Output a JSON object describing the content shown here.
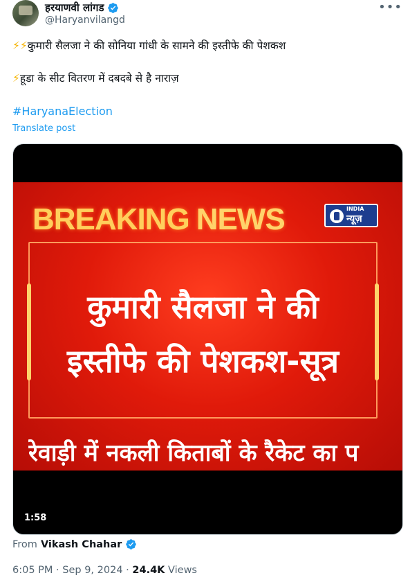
{
  "author": {
    "display_name": "हरयाणवी लांगड",
    "handle": "@Haryanvilangd",
    "verified": true
  },
  "post": {
    "line1_bolts": "⚡⚡",
    "line1_text": "कुमारी सैलजा ने की सोनिया गांधी के सामने की इस्तीफे की पेशकश",
    "line2_bolts": "⚡",
    "line2_text": "हूडा के सीट वितरण में दबदबे से है नाराज़",
    "hashtag": "#HaryanaElection",
    "translate_label": "Translate post"
  },
  "media": {
    "breaking_word1": "BREAKING",
    "breaking_word2": "NEWS",
    "channel_logo_top": "INDIA",
    "channel_logo_main": "न्यूज़",
    "headline_line1": "कुमारी सैलजा ने की",
    "headline_line2": "इस्तीफे की पेशकश-सूत्र",
    "ticker": "रेवाड़ी में नकली किताबों के रैकेट का प",
    "duration": "1:58"
  },
  "attribution": {
    "from_label": "From",
    "from_name": "Vikash Chahar",
    "verified": true
  },
  "meta": {
    "time": "6:05 PM",
    "separator1": "·",
    "date": "Sep 9, 2024",
    "separator2": "·",
    "views_count": "24.4K",
    "views_label": "Views"
  },
  "colors": {
    "accent": "#1d9bf0",
    "text": "#0f1419",
    "muted": "#536471"
  },
  "icons": [
    "verified-badge-icon",
    "more-options-icon"
  ]
}
